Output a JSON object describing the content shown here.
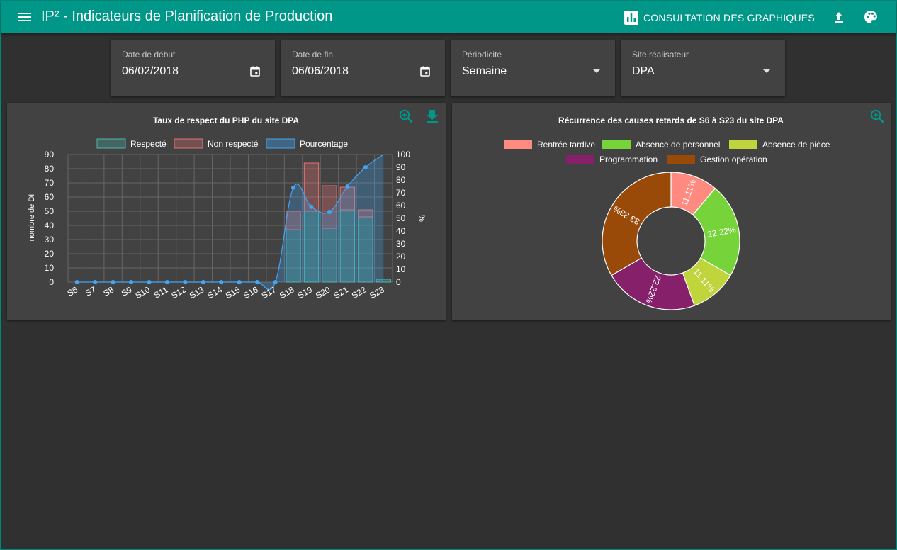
{
  "app": {
    "title": "IP² - Indicateurs de Planification de Production",
    "consult_label": "CONSULTATION DES GRAPHIQUES",
    "accent": "#009688",
    "icons": [
      "menu-icon",
      "bar-chart-icon",
      "upload-icon",
      "palette-icon"
    ]
  },
  "filters": {
    "start": {
      "label": "Date de début",
      "value": "06/02/2018"
    },
    "end": {
      "label": "Date de fin",
      "value": "06/06/2018"
    },
    "period": {
      "label": "Périodicité",
      "value": "Semaine"
    },
    "site": {
      "label": "Site réalisateur",
      "value": "DPA"
    }
  },
  "chart_data": [
    {
      "type": "bar",
      "title": "Taux de respect du PHP du site DPA",
      "ylabel": "nombre de DI",
      "y2label": "%",
      "ylim": [
        0,
        90
      ],
      "y2lim": [
        0,
        100
      ],
      "yticks": [
        0,
        10,
        20,
        30,
        40,
        50,
        60,
        70,
        80,
        90
      ],
      "y2ticks": [
        0,
        10,
        20,
        30,
        40,
        50,
        60,
        70,
        80,
        90,
        100
      ],
      "stacked": true,
      "grid": true,
      "legend": "top",
      "categories": [
        "S6",
        "S7",
        "S8",
        "S9",
        "S10",
        "S11",
        "S12",
        "S13",
        "S14",
        "S15",
        "S16",
        "S17",
        "S18",
        "S19",
        "S20",
        "S21",
        "S22",
        "S23"
      ],
      "series": [
        {
          "name": "Respecté",
          "kind": "bar",
          "color": "#4db6ac",
          "values": [
            0,
            0,
            0,
            0,
            0,
            0,
            0,
            0,
            0,
            0,
            0,
            0,
            37,
            50,
            38,
            51,
            46,
            2
          ]
        },
        {
          "name": "Non respecté",
          "kind": "bar",
          "color": "#e57373",
          "values": [
            0,
            0,
            0,
            0,
            0,
            0,
            0,
            0,
            0,
            0,
            0,
            0,
            13,
            34,
            30,
            16,
            5,
            0
          ]
        },
        {
          "name": "Pourcentage",
          "kind": "line",
          "axis": "right",
          "color": "#42a5f5",
          "values": [
            0,
            0,
            0,
            0,
            0,
            0,
            0,
            0,
            0,
            0,
            0,
            0,
            74,
            59,
            55,
            75,
            90,
            100
          ]
        }
      ]
    },
    {
      "type": "pie",
      "donut": true,
      "title": "Récurrence des causes retards de S6 à S23 du site DPA",
      "legend": "top",
      "slices": [
        {
          "label": "Rentrée tardive",
          "value": 11.11,
          "text": "11.11%",
          "color": "#ff8a80"
        },
        {
          "label": "Absence de personnel",
          "value": 22.22,
          "text": "22.22%",
          "color": "#76d33a"
        },
        {
          "label": "Absence de pièce",
          "value": 11.11,
          "text": "11.11%",
          "color": "#c0d43c"
        },
        {
          "label": "Programmation",
          "value": 22.22,
          "text": "22.22%",
          "color": "#86206b"
        },
        {
          "label": "Gestion opération",
          "value": 33.33,
          "text": "33.33%",
          "color": "#9a4a08"
        }
      ]
    }
  ]
}
